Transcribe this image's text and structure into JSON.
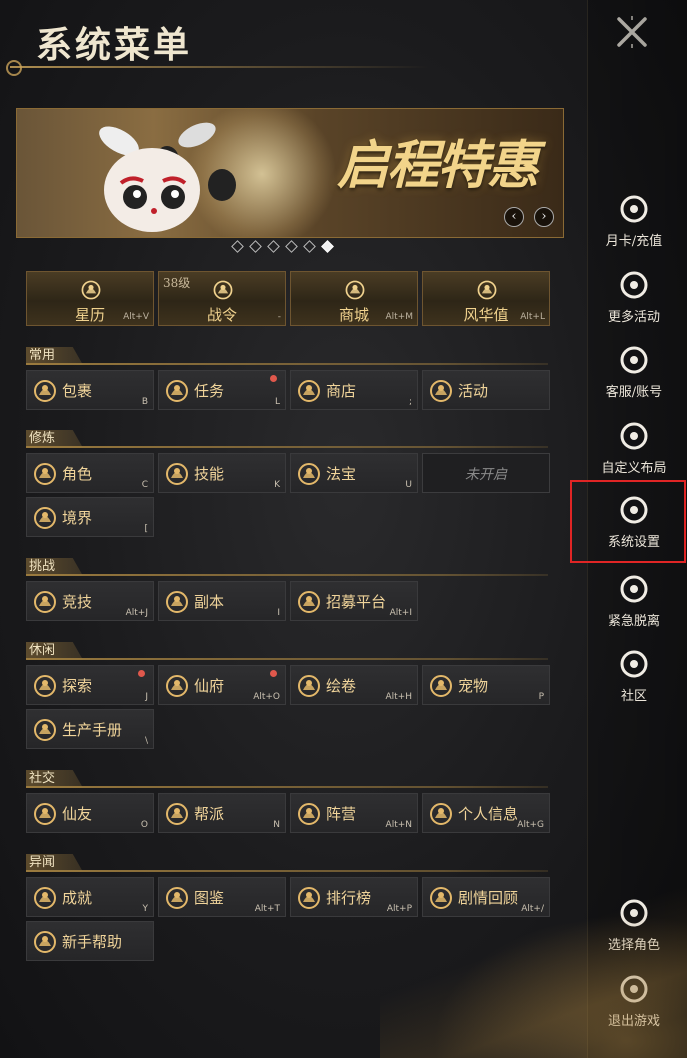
{
  "title": "系统菜单",
  "banner": {
    "text": "启程特惠",
    "active_dot": 5,
    "dot_count": 6
  },
  "top_buttons": [
    {
      "label": "星历",
      "hotkey": "Alt+V",
      "icon": "calendar-icon",
      "level": ""
    },
    {
      "label": "战令",
      "hotkey": "-",
      "icon": "battle-pass-icon",
      "level": "38级"
    },
    {
      "label": "商城",
      "hotkey": "Alt+M",
      "icon": "mall-icon",
      "level": ""
    },
    {
      "label": "风华值",
      "hotkey": "Alt+L",
      "icon": "elegance-icon",
      "level": ""
    }
  ],
  "sections": [
    {
      "name": "常用",
      "items": [
        {
          "label": "包裹",
          "hotkey": "B",
          "icon": "bag-icon",
          "dot": false
        },
        {
          "label": "任务",
          "hotkey": "L",
          "icon": "quest-icon",
          "dot": true
        },
        {
          "label": "商店",
          "hotkey": ";",
          "icon": "shop-icon",
          "dot": false
        },
        {
          "label": "活动",
          "hotkey": "",
          "icon": "activity-icon",
          "dot": false
        }
      ]
    },
    {
      "name": "修炼",
      "items": [
        {
          "label": "角色",
          "hotkey": "C",
          "icon": "character-icon",
          "dot": false
        },
        {
          "label": "技能",
          "hotkey": "K",
          "icon": "skill-icon",
          "dot": false
        },
        {
          "label": "法宝",
          "hotkey": "U",
          "icon": "treasure-icon",
          "dot": false
        },
        {
          "label": "未开启",
          "hotkey": "",
          "icon": "",
          "dot": false,
          "locked": true
        },
        {
          "label": "境界",
          "hotkey": "[",
          "icon": "realm-icon",
          "dot": false
        }
      ]
    },
    {
      "name": "挑战",
      "items": [
        {
          "label": "竞技",
          "hotkey": "Alt+J",
          "icon": "arena-icon",
          "dot": false
        },
        {
          "label": "副本",
          "hotkey": "I",
          "icon": "dungeon-icon",
          "dot": false
        },
        {
          "label": "招募平台",
          "hotkey": "Alt+I",
          "icon": "recruit-icon",
          "dot": false
        }
      ]
    },
    {
      "name": "休闲",
      "items": [
        {
          "label": "探索",
          "hotkey": "J",
          "icon": "explore-icon",
          "dot": true
        },
        {
          "label": "仙府",
          "hotkey": "Alt+O",
          "icon": "mansion-icon",
          "dot": true
        },
        {
          "label": "绘卷",
          "hotkey": "Alt+H",
          "icon": "scroll-icon",
          "dot": false
        },
        {
          "label": "宠物",
          "hotkey": "P",
          "icon": "pet-icon",
          "dot": false
        },
        {
          "label": "生产手册",
          "hotkey": "\\",
          "icon": "crafting-icon",
          "dot": false
        }
      ]
    },
    {
      "name": "社交",
      "items": [
        {
          "label": "仙友",
          "hotkey": "O",
          "icon": "friends-icon",
          "dot": false
        },
        {
          "label": "帮派",
          "hotkey": "N",
          "icon": "guild-icon",
          "dot": false
        },
        {
          "label": "阵营",
          "hotkey": "Alt+N",
          "icon": "faction-icon",
          "dot": false
        },
        {
          "label": "个人信息",
          "hotkey": "Alt+G",
          "icon": "profile-icon",
          "dot": false
        }
      ]
    },
    {
      "name": "异闻",
      "items": [
        {
          "label": "成就",
          "hotkey": "Y",
          "icon": "achievement-icon",
          "dot": false
        },
        {
          "label": "图鉴",
          "hotkey": "Alt+T",
          "icon": "codex-icon",
          "dot": false
        },
        {
          "label": "排行榜",
          "hotkey": "Alt+P",
          "icon": "ranking-icon",
          "dot": false
        },
        {
          "label": "剧情回顾",
          "hotkey": "Alt+/",
          "icon": "story-icon",
          "dot": false
        },
        {
          "label": "新手帮助",
          "hotkey": "",
          "icon": "help-icon",
          "dot": false
        }
      ]
    }
  ],
  "sidebar": [
    {
      "label": "月卡/充值",
      "icon": "recharge-icon"
    },
    {
      "label": "更多活动",
      "icon": "more-activities-icon"
    },
    {
      "label": "客服/账号",
      "icon": "support-icon"
    },
    {
      "label": "自定义布局",
      "icon": "layout-icon"
    },
    {
      "label": "系统设置",
      "icon": "settings-icon"
    },
    {
      "label": "紧急脱离",
      "icon": "warning-icon"
    },
    {
      "label": "社区",
      "icon": "community-icon"
    },
    {
      "label": "选择角色",
      "icon": "switch-character-icon"
    },
    {
      "label": "退出游戏",
      "icon": "exit-icon"
    }
  ]
}
